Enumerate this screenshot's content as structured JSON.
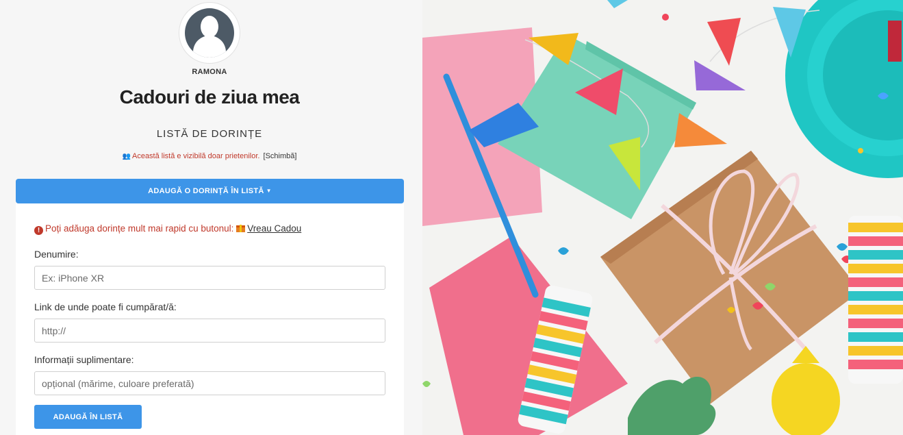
{
  "profile": {
    "username": "RAMONA"
  },
  "list": {
    "title": "Cadouri de ziua mea",
    "subtitle": "LISTĂ DE DORINȚE",
    "visibility_text": "Această listă e vizibilă doar prietenilor.",
    "visibility_change": "[Schimbă]"
  },
  "add_panel": {
    "toggle_label": "ADAUGĂ O DORINȚĂ ÎN LISTĂ",
    "tip_text": "Poți adăuga dorințe mult mai rapid cu butonul:",
    "tip_link": "Vreau Cadou",
    "fields": {
      "name_label": "Denumire:",
      "name_placeholder": "Ex: iPhone XR",
      "link_label": "Link de unde poate fi cumpărat/ă:",
      "link_placeholder": "http://",
      "info_label": "Informații suplimentare:",
      "info_placeholder": "opțional (mărime, culoare preferată)"
    },
    "submit_label": "ADAUGĂ ÎN LISTĂ"
  },
  "colors": {
    "accent": "#3d95e8",
    "alert": "#c0392b"
  },
  "icons": {
    "visibility": "users-icon",
    "caret": "caret-down-icon",
    "tip": "exclamation-circle-icon",
    "gift": "gift-icon"
  }
}
